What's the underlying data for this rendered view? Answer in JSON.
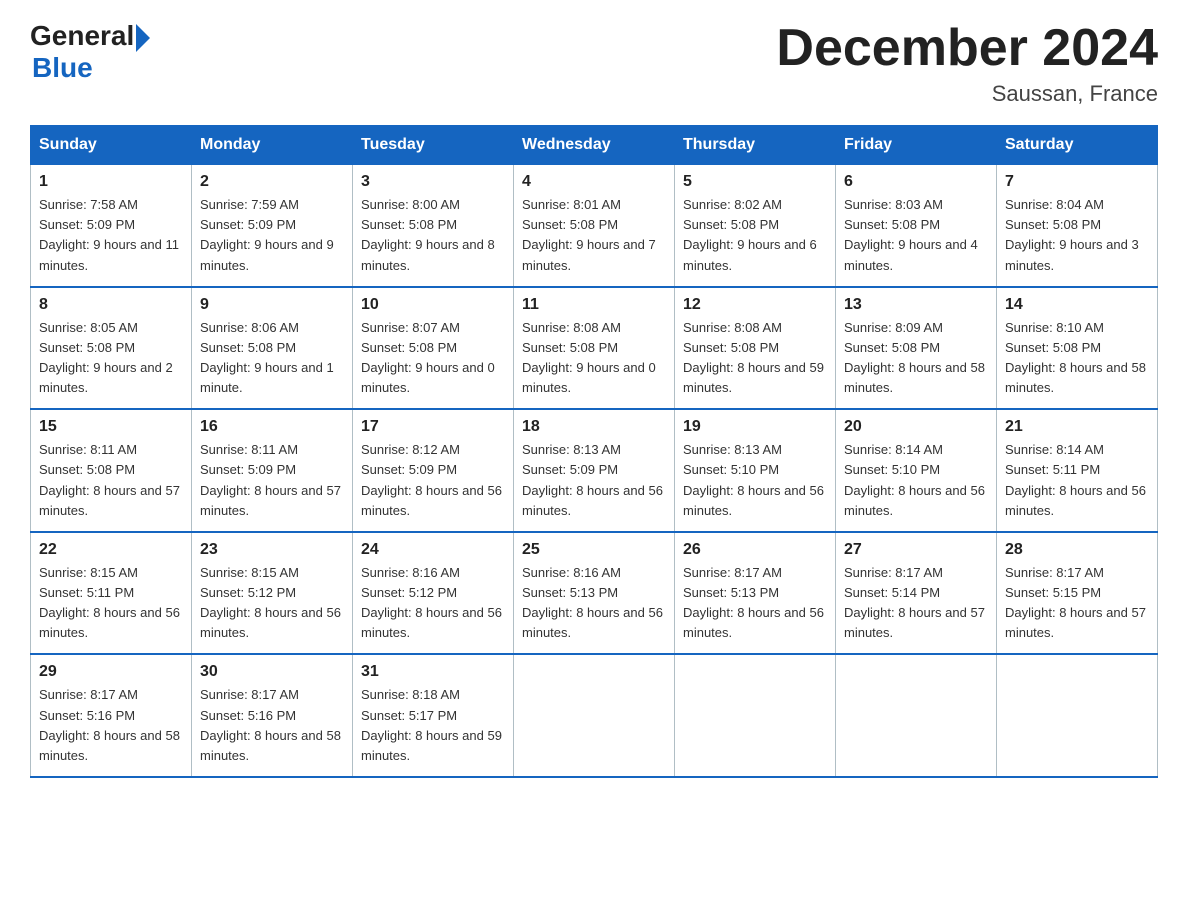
{
  "logo": {
    "general": "General",
    "blue": "Blue"
  },
  "header": {
    "month_year": "December 2024",
    "location": "Saussan, France"
  },
  "days_of_week": [
    "Sunday",
    "Monday",
    "Tuesday",
    "Wednesday",
    "Thursday",
    "Friday",
    "Saturday"
  ],
  "weeks": [
    [
      {
        "day": "1",
        "sunrise": "7:58 AM",
        "sunset": "5:09 PM",
        "daylight": "9 hours and 11 minutes."
      },
      {
        "day": "2",
        "sunrise": "7:59 AM",
        "sunset": "5:09 PM",
        "daylight": "9 hours and 9 minutes."
      },
      {
        "day": "3",
        "sunrise": "8:00 AM",
        "sunset": "5:08 PM",
        "daylight": "9 hours and 8 minutes."
      },
      {
        "day": "4",
        "sunrise": "8:01 AM",
        "sunset": "5:08 PM",
        "daylight": "9 hours and 7 minutes."
      },
      {
        "day": "5",
        "sunrise": "8:02 AM",
        "sunset": "5:08 PM",
        "daylight": "9 hours and 6 minutes."
      },
      {
        "day": "6",
        "sunrise": "8:03 AM",
        "sunset": "5:08 PM",
        "daylight": "9 hours and 4 minutes."
      },
      {
        "day": "7",
        "sunrise": "8:04 AM",
        "sunset": "5:08 PM",
        "daylight": "9 hours and 3 minutes."
      }
    ],
    [
      {
        "day": "8",
        "sunrise": "8:05 AM",
        "sunset": "5:08 PM",
        "daylight": "9 hours and 2 minutes."
      },
      {
        "day": "9",
        "sunrise": "8:06 AM",
        "sunset": "5:08 PM",
        "daylight": "9 hours and 1 minute."
      },
      {
        "day": "10",
        "sunrise": "8:07 AM",
        "sunset": "5:08 PM",
        "daylight": "9 hours and 0 minutes."
      },
      {
        "day": "11",
        "sunrise": "8:08 AM",
        "sunset": "5:08 PM",
        "daylight": "9 hours and 0 minutes."
      },
      {
        "day": "12",
        "sunrise": "8:08 AM",
        "sunset": "5:08 PM",
        "daylight": "8 hours and 59 minutes."
      },
      {
        "day": "13",
        "sunrise": "8:09 AM",
        "sunset": "5:08 PM",
        "daylight": "8 hours and 58 minutes."
      },
      {
        "day": "14",
        "sunrise": "8:10 AM",
        "sunset": "5:08 PM",
        "daylight": "8 hours and 58 minutes."
      }
    ],
    [
      {
        "day": "15",
        "sunrise": "8:11 AM",
        "sunset": "5:08 PM",
        "daylight": "8 hours and 57 minutes."
      },
      {
        "day": "16",
        "sunrise": "8:11 AM",
        "sunset": "5:09 PM",
        "daylight": "8 hours and 57 minutes."
      },
      {
        "day": "17",
        "sunrise": "8:12 AM",
        "sunset": "5:09 PM",
        "daylight": "8 hours and 56 minutes."
      },
      {
        "day": "18",
        "sunrise": "8:13 AM",
        "sunset": "5:09 PM",
        "daylight": "8 hours and 56 minutes."
      },
      {
        "day": "19",
        "sunrise": "8:13 AM",
        "sunset": "5:10 PM",
        "daylight": "8 hours and 56 minutes."
      },
      {
        "day": "20",
        "sunrise": "8:14 AM",
        "sunset": "5:10 PM",
        "daylight": "8 hours and 56 minutes."
      },
      {
        "day": "21",
        "sunrise": "8:14 AM",
        "sunset": "5:11 PM",
        "daylight": "8 hours and 56 minutes."
      }
    ],
    [
      {
        "day": "22",
        "sunrise": "8:15 AM",
        "sunset": "5:11 PM",
        "daylight": "8 hours and 56 minutes."
      },
      {
        "day": "23",
        "sunrise": "8:15 AM",
        "sunset": "5:12 PM",
        "daylight": "8 hours and 56 minutes."
      },
      {
        "day": "24",
        "sunrise": "8:16 AM",
        "sunset": "5:12 PM",
        "daylight": "8 hours and 56 minutes."
      },
      {
        "day": "25",
        "sunrise": "8:16 AM",
        "sunset": "5:13 PM",
        "daylight": "8 hours and 56 minutes."
      },
      {
        "day": "26",
        "sunrise": "8:17 AM",
        "sunset": "5:13 PM",
        "daylight": "8 hours and 56 minutes."
      },
      {
        "day": "27",
        "sunrise": "8:17 AM",
        "sunset": "5:14 PM",
        "daylight": "8 hours and 57 minutes."
      },
      {
        "day": "28",
        "sunrise": "8:17 AM",
        "sunset": "5:15 PM",
        "daylight": "8 hours and 57 minutes."
      }
    ],
    [
      {
        "day": "29",
        "sunrise": "8:17 AM",
        "sunset": "5:16 PM",
        "daylight": "8 hours and 58 minutes."
      },
      {
        "day": "30",
        "sunrise": "8:17 AM",
        "sunset": "5:16 PM",
        "daylight": "8 hours and 58 minutes."
      },
      {
        "day": "31",
        "sunrise": "8:18 AM",
        "sunset": "5:17 PM",
        "daylight": "8 hours and 59 minutes."
      },
      null,
      null,
      null,
      null
    ]
  ],
  "labels": {
    "sunrise": "Sunrise:",
    "sunset": "Sunset:",
    "daylight": "Daylight:"
  }
}
